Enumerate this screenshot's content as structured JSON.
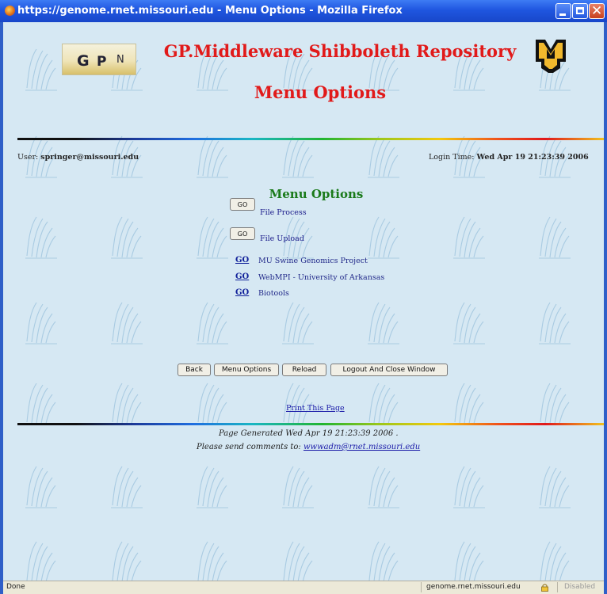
{
  "window": {
    "title": "https://genome.rnet.missouri.edu - Menu Options - Mozilla Firefox"
  },
  "header": {
    "logo_left": {
      "g": "G",
      "p": "P",
      "n": "N"
    },
    "title": "GP.Middleware Shibboleth Repository",
    "subtitle": "Menu Options"
  },
  "session": {
    "user_label": "User:",
    "user_value": "springer@missouri.edu",
    "login_label": "Login Time:",
    "login_value": "Wed Apr 19 21:23:39 2006"
  },
  "menu": {
    "title": "Menu Options",
    "buttons": [
      {
        "button": "GO",
        "label": "File Process"
      },
      {
        "button": "GO",
        "label": "File Upload"
      }
    ],
    "links": [
      {
        "go": "GO",
        "label": "MU Swine Genomics Project"
      },
      {
        "go": "GO",
        "label": "WebMPI - University of Arkansas"
      },
      {
        "go": "GO",
        "label": "Biotools"
      }
    ]
  },
  "nav": {
    "back": "Back",
    "menu_options": "Menu Options",
    "reload": "Reload",
    "logout": "Logout And Close Window"
  },
  "print_link": "Print This Page",
  "footer": {
    "generated": "Page Generated Wed Apr 19 21:23:39 2006 .",
    "comments_prefix": "Please send comments to:",
    "email": "wwwadm@rnet.missouri.edu"
  },
  "statusbar": {
    "status": "Done",
    "host": "genome.rnet.missouri.edu",
    "popup": "Disabled"
  },
  "colors": {
    "title_red": "#e11a1a",
    "section_green": "#1a7a1a",
    "background": "#d6e8f3"
  }
}
